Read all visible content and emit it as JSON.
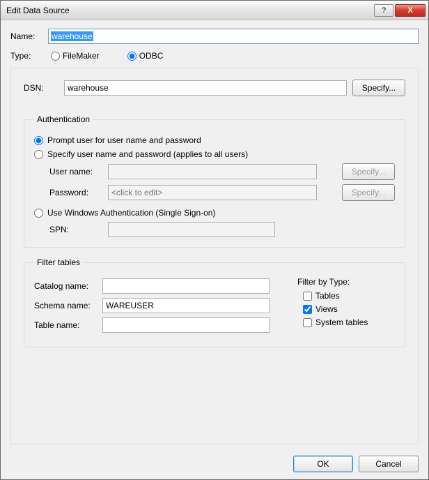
{
  "window": {
    "title": "Edit Data Source"
  },
  "labels": {
    "name": "Name:",
    "type": "Type:",
    "filemaker": "FileMaker",
    "odbc": "ODBC",
    "dsn": "DSN:",
    "specify": "Specify...",
    "auth_legend": "Authentication",
    "auth_prompt": "Prompt user for user name and password",
    "auth_specify": "Specify user name and password (applies to all users)",
    "auth_windows": "Use Windows Authentication (Single Sign-on)",
    "username": "User name:",
    "password": "Password:",
    "password_placeholder": "<click to edit>",
    "spn": "SPN:",
    "filter_legend": "Filter tables",
    "catalog": "Catalog name:",
    "schema": "Schema name:",
    "table": "Table name:",
    "filter_by_type": "Filter by Type:",
    "tables_chk": "Tables",
    "views_chk": "Views",
    "system_chk": "System tables",
    "ok": "OK",
    "cancel": "Cancel",
    "help": "?",
    "close_x": "X"
  },
  "values": {
    "name": "warehouse",
    "type": "odbc",
    "dsn": "warehouse",
    "auth_mode": "prompt",
    "username": "",
    "password": "",
    "spn": "",
    "catalog": "",
    "schema": "WAREUSER",
    "table": "",
    "filter_tables": false,
    "filter_views": true,
    "filter_system": false
  }
}
